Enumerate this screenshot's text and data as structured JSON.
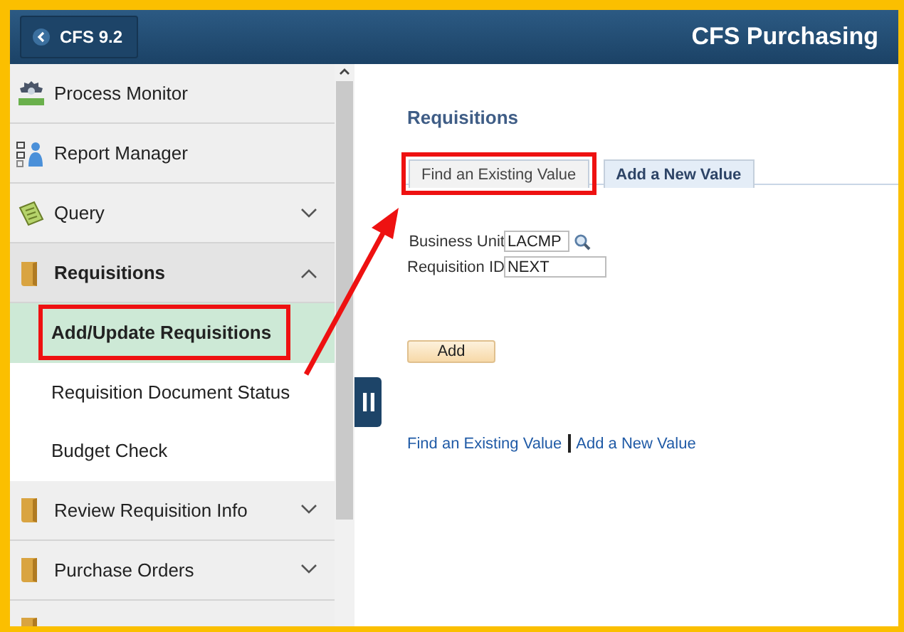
{
  "header": {
    "back_button": "CFS 9.2",
    "title": "CFS Purchasing"
  },
  "nav": {
    "items": [
      {
        "kind": "monitor",
        "label": "Process Monitor"
      },
      {
        "kind": "report",
        "label": "Report Manager"
      },
      {
        "kind": "query",
        "label": "Query",
        "expanded": false
      },
      {
        "kind": "folder",
        "label": "Requisitions",
        "expanded": true,
        "children": [
          {
            "label": "Add/Update Requisitions",
            "selected": true,
            "highlighted": true
          },
          {
            "label": "Requisition Document Status",
            "selected": false,
            "highlighted": false
          },
          {
            "label": "Budget Check",
            "selected": false,
            "highlighted": false
          }
        ]
      },
      {
        "kind": "folder",
        "label": "Review Requisition Info",
        "expanded": false
      },
      {
        "kind": "folder",
        "label": "Purchase Orders",
        "expanded": false
      },
      {
        "kind": "cutoff"
      }
    ]
  },
  "content": {
    "title": "Requisitions",
    "tabs": [
      {
        "label": "Find an Existing Value",
        "selected": false,
        "highlighted": true
      },
      {
        "label": "Add a New Value",
        "selected": true,
        "highlighted": false
      }
    ],
    "fields": [
      {
        "label": "Business Unit",
        "value": "LACMP",
        "lookup": true
      },
      {
        "label": "Requisition ID",
        "value": "NEXT",
        "lookup": false
      }
    ],
    "add_button": "Add",
    "footer_links": [
      "Find an Existing Value",
      "Add a New Value"
    ]
  }
}
